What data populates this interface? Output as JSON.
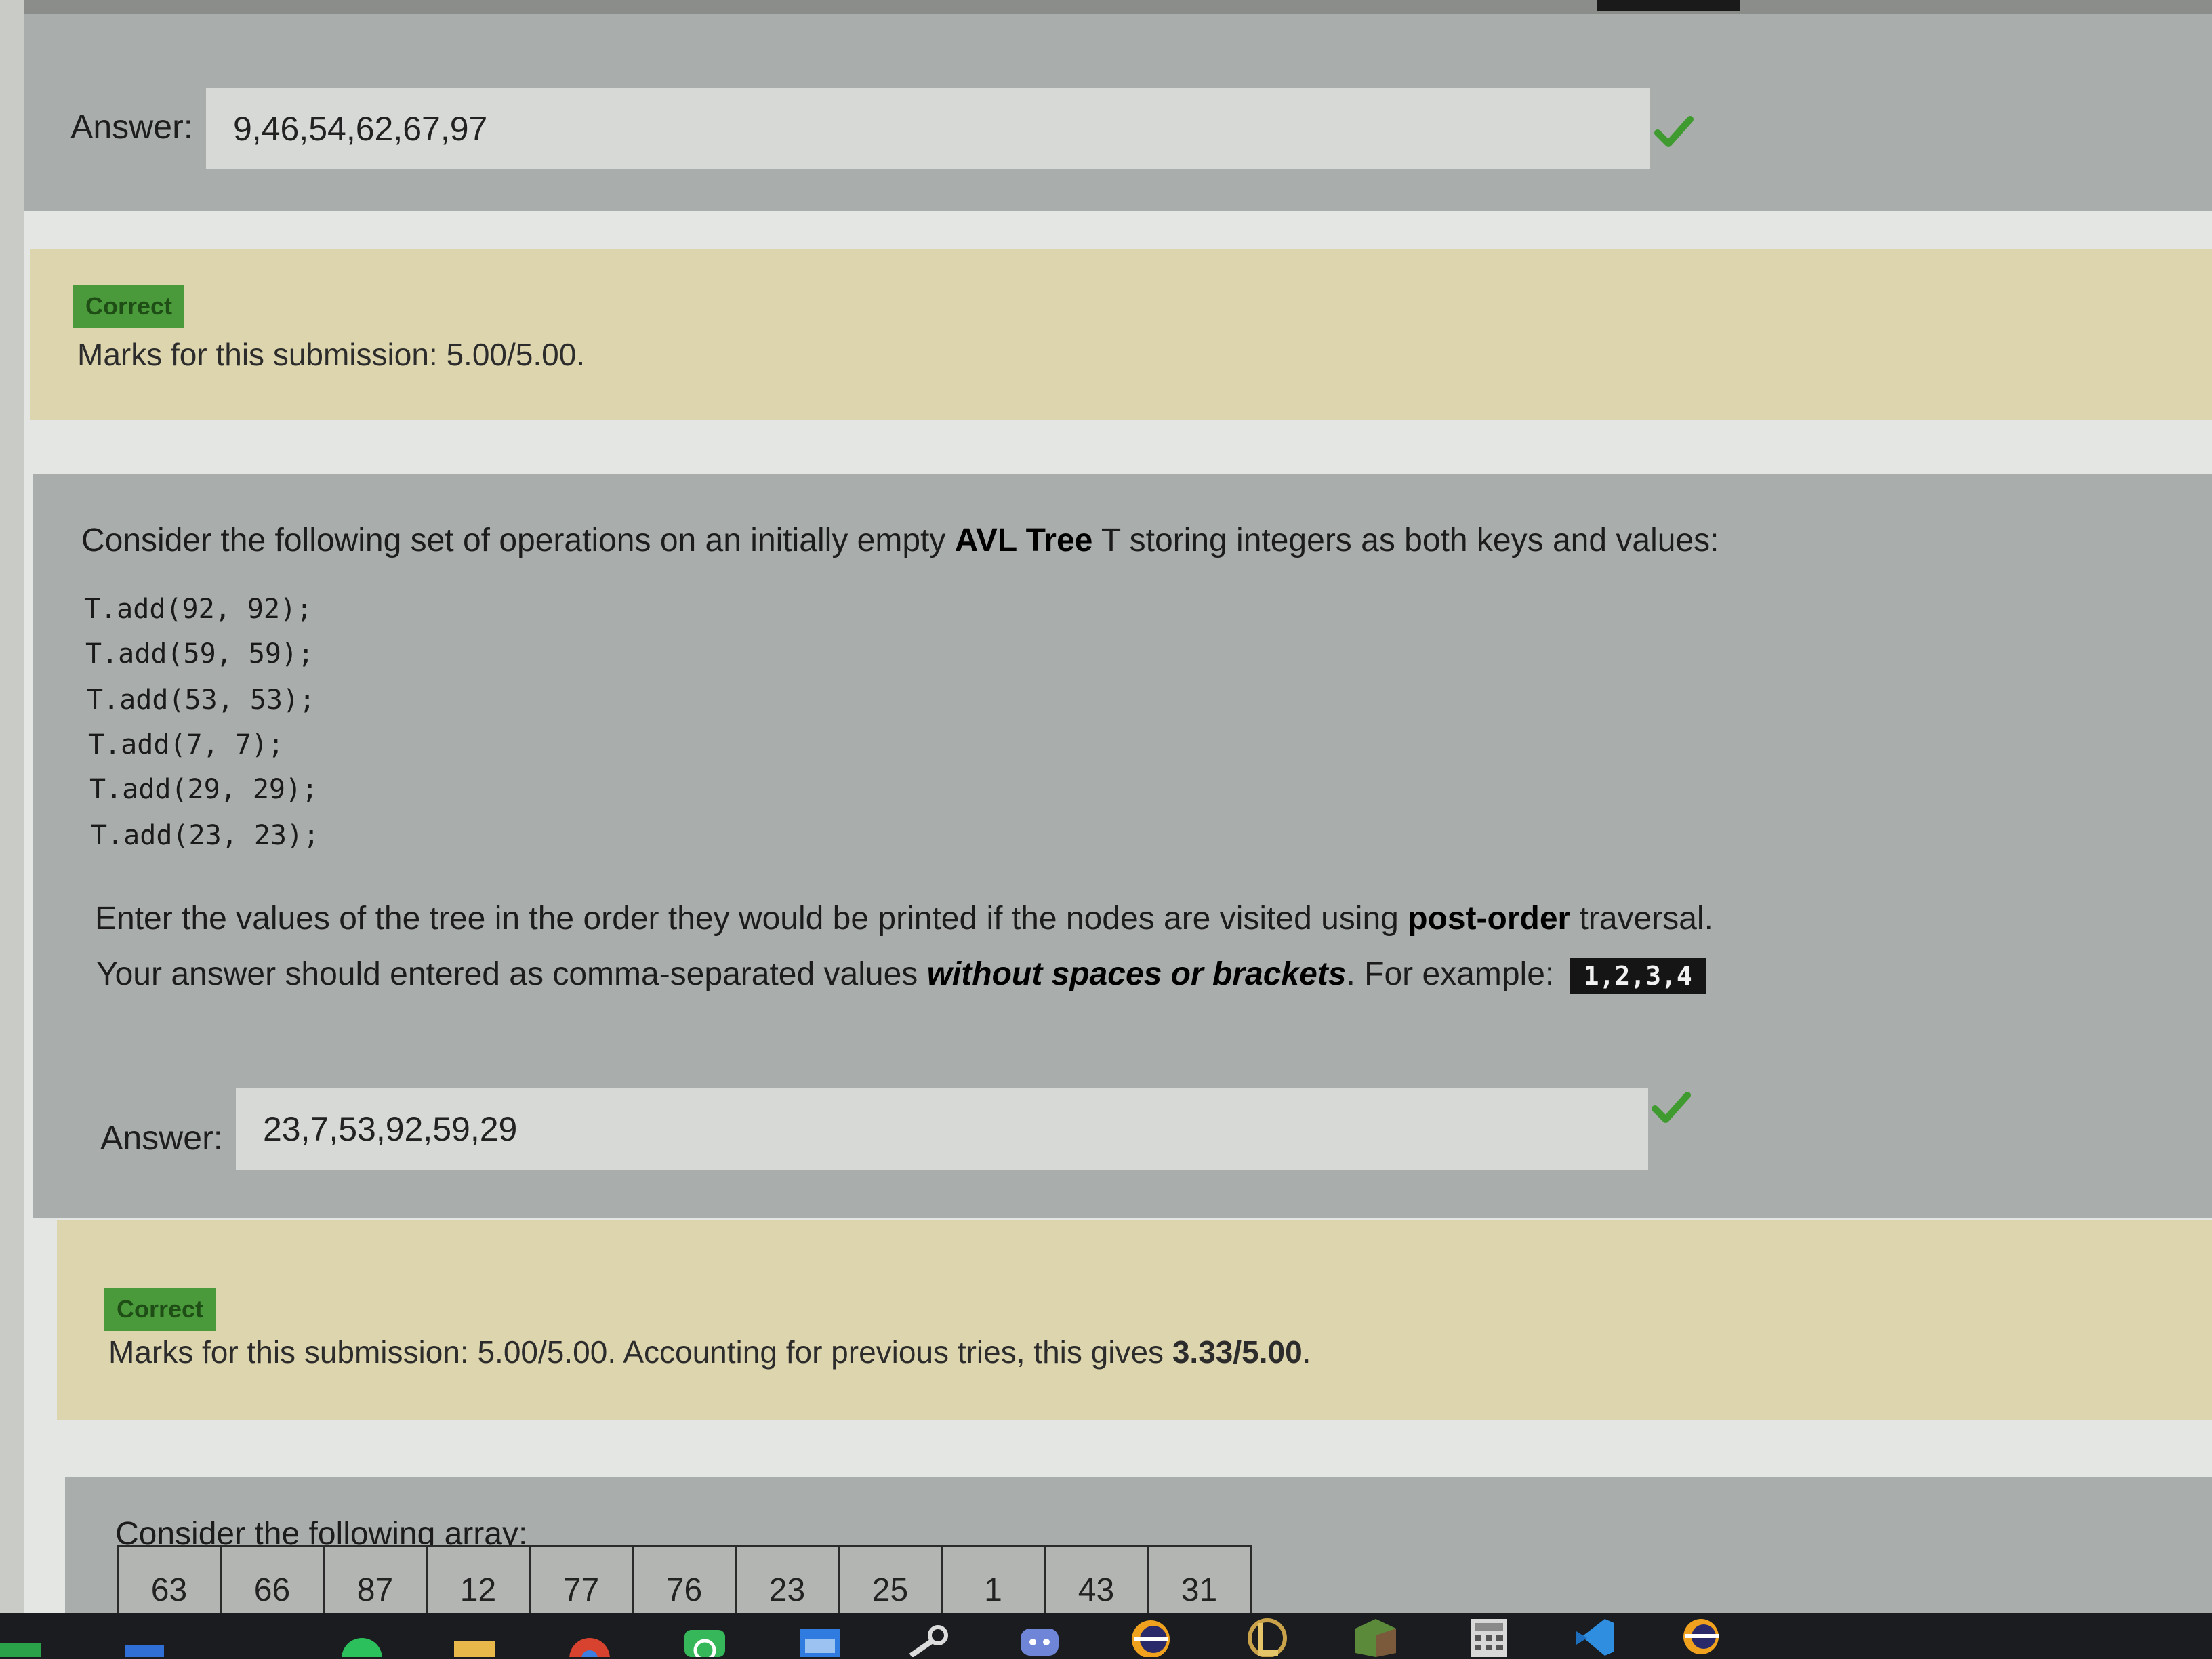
{
  "block1": {
    "answer_label": "Answer:",
    "answer_value": "9,46,54,62,67,97"
  },
  "feedback1": {
    "badge": "Correct",
    "marks": "Marks for this submission: 5.00/5.00."
  },
  "question2": {
    "intro_before": "Consider the following set of operations on an initially empty ",
    "intro_bold": "AVL Tree",
    "intro_after": " T storing integers as both keys and values:",
    "code_lines": [
      "T.add(92, 92);",
      "T.add(59, 59);",
      "T.add(53, 53);",
      "T.add(7, 7);",
      "T.add(29, 29);",
      "T.add(23, 23);"
    ],
    "instr_before": "Enter the values of the tree in the order they would be printed if the nodes are visited using ",
    "instr_bold": "post-order",
    "instr_after": " traversal.",
    "format_before": "Your answer should entered as comma-separated values ",
    "format_bold": "without spaces or brackets",
    "format_after": ". For example: ",
    "example": "1,2,3,4",
    "answer_label": "Answer:",
    "answer_value": "23,7,53,92,59,29"
  },
  "feedback2": {
    "badge": "Correct",
    "marks_before": "Marks for this submission: 5.00/5.00. Accounting for previous tries, this gives ",
    "marks_bold": "3.33/5.00",
    "marks_after": "."
  },
  "question3": {
    "intro": "Consider the following array:",
    "array": [
      "63",
      "66",
      "87",
      "12",
      "77",
      "76",
      "23",
      "25",
      "1",
      "43",
      "31"
    ]
  },
  "colors": {
    "correct_green": "#4a9a3c",
    "check_green": "#3f9b2f",
    "question_bg": "#a9adab",
    "feedback_bg": "#ddd5ad"
  }
}
